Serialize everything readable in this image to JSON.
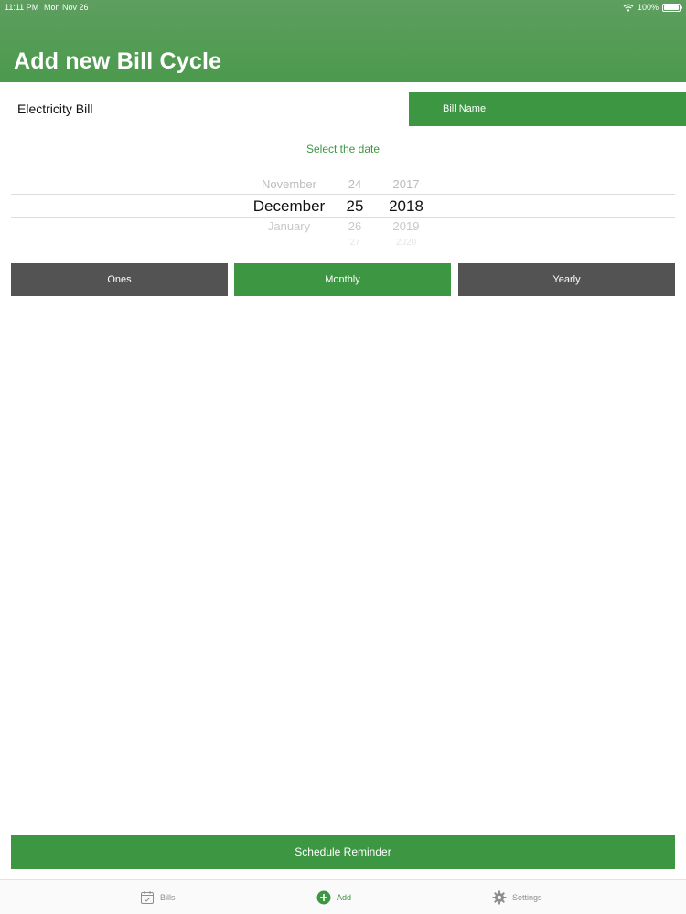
{
  "status_bar": {
    "time": "11:11 PM",
    "date": "Mon Nov 26",
    "battery": "100%"
  },
  "page": {
    "title": "Add new Bill Cycle"
  },
  "bill": {
    "name_value": "Electricity Bill",
    "name_button_label": "Bill Name"
  },
  "date_picker": {
    "caption": "Select the date",
    "month": {
      "prev": "November",
      "selected": "December",
      "next": "January"
    },
    "day": {
      "prev": "24",
      "selected": "25",
      "next": "26",
      "next2": "27"
    },
    "year": {
      "prev": "2017",
      "selected": "2018",
      "next": "2019",
      "next2": "2020"
    }
  },
  "frequency": {
    "options": [
      "Ones",
      "Monthly",
      "Yearly"
    ],
    "selected": "Monthly"
  },
  "actions": {
    "schedule_label": "Schedule Reminder"
  },
  "tabs": [
    {
      "label": "Bills",
      "icon": "calendar-icon",
      "active": false
    },
    {
      "label": "Add",
      "icon": "plus-circle-icon",
      "active": true
    },
    {
      "label": "Settings",
      "icon": "gear-icon",
      "active": false
    }
  ],
  "colors": {
    "header": "#5e9e5f",
    "accent_green": "#3d9642",
    "unselected_button": "#535354",
    "inactive_tab": "#8e8e8e"
  }
}
